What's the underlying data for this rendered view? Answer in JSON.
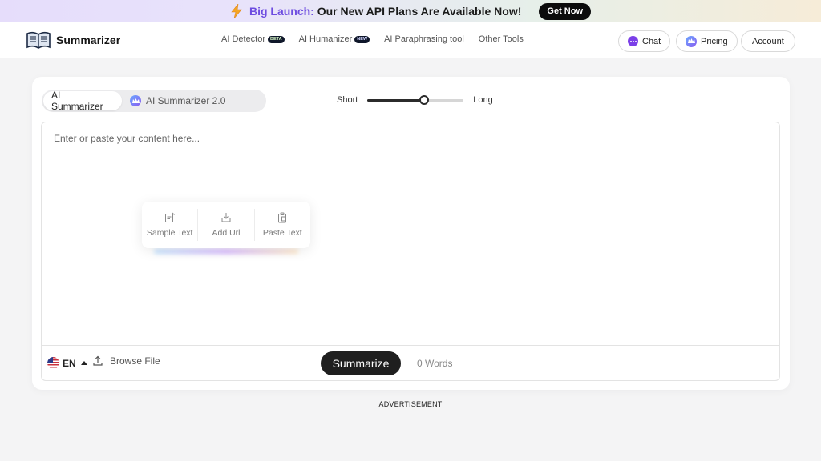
{
  "banner": {
    "highlight": "Big Launch:",
    "text": " Our New API Plans Are Available Now!",
    "button": "Get Now"
  },
  "header": {
    "logo": "Summarizer",
    "nav": [
      {
        "label": "AI Detector",
        "tag": "BETA"
      },
      {
        "label": "AI Humanizer",
        "tag": "NEW"
      },
      {
        "label": "AI Paraphrasing tool"
      },
      {
        "label": "Other Tools"
      }
    ],
    "chat": "Chat",
    "pricing": "Pricing",
    "account": "Account"
  },
  "tabs": {
    "tab1": "AI Summarizer",
    "tab2": "AI Summarizer 2.0"
  },
  "slider": {
    "min_label": "Short",
    "max_label": "Long",
    "value": 0.59
  },
  "editor": {
    "placeholder": "Enter or paste your content here...",
    "quick_actions": [
      "Sample Text",
      "Add Url",
      "Paste Text"
    ],
    "lang": "EN",
    "browse": "Browse File",
    "summarize": "Summarize",
    "words": "0 Words"
  },
  "advertisement": "ADVERTISEMENT",
  "colors": {
    "accent_purple": "#6d4ce0",
    "dark": "#1f1f1f"
  }
}
